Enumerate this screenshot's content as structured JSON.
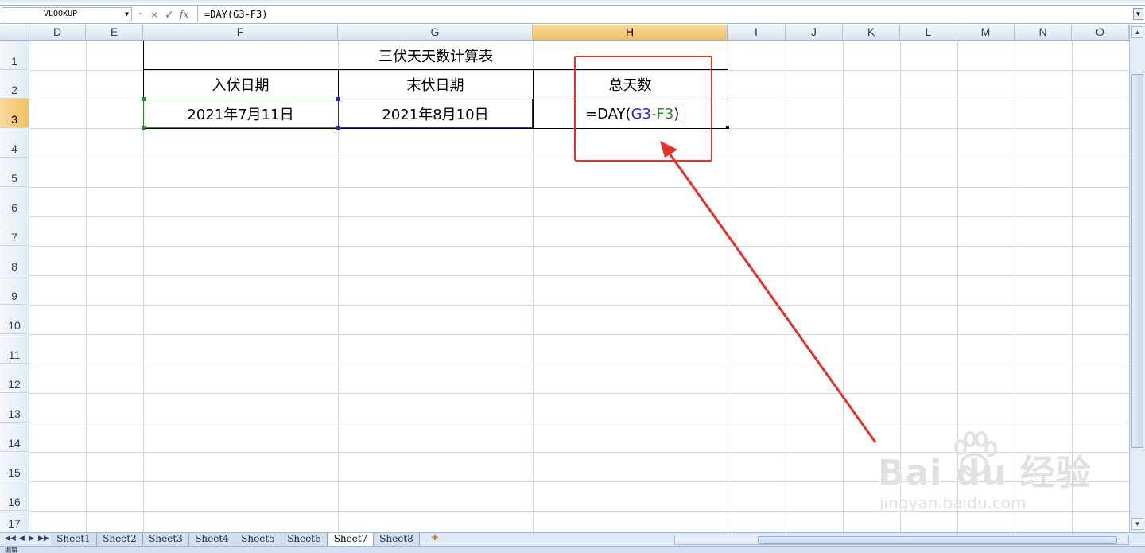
{
  "formula_bar": {
    "name_box": "VLOOKUP",
    "formula": "=DAY(G3-F3)",
    "buttons": [
      "×",
      "✓",
      "fx"
    ]
  },
  "columns": [
    "D",
    "E",
    "F",
    "G",
    "H",
    "I",
    "J",
    "K",
    "L",
    "M",
    "N",
    "O"
  ],
  "selected_column": "H",
  "rows": [
    "1",
    "2",
    "3",
    "4",
    "5",
    "6",
    "7",
    "8",
    "9",
    "10",
    "11",
    "12",
    "13",
    "14",
    "15",
    "16",
    "17"
  ],
  "selected_row": "3",
  "table": {
    "title": "三伏天天数计算表",
    "headers": [
      "入伏日期",
      "末伏日期",
      "总天数"
    ],
    "values": {
      "start": "2021年7月11日",
      "end": "2021年8月10日",
      "formula_prefix": "=DAY(",
      "ref_g3": "G3",
      "minus": "-",
      "ref_f3": "F3",
      "close": ")"
    }
  },
  "sheet_tabs": [
    "Sheet1",
    "Sheet2",
    "Sheet3",
    "Sheet4",
    "Sheet5",
    "Sheet6",
    "Sheet7",
    "Sheet8"
  ],
  "active_tab": "Sheet7",
  "status": {
    "mode": "编辑"
  },
  "watermark": {
    "brand": "Bai du 经验",
    "url": "jingyan.baidu.com"
  },
  "colors": {
    "highlight_red": "#e8302a",
    "ref_blue": "#2828c8",
    "ref_green": "#2b8a2b",
    "selected_header": "#f1c15f"
  }
}
